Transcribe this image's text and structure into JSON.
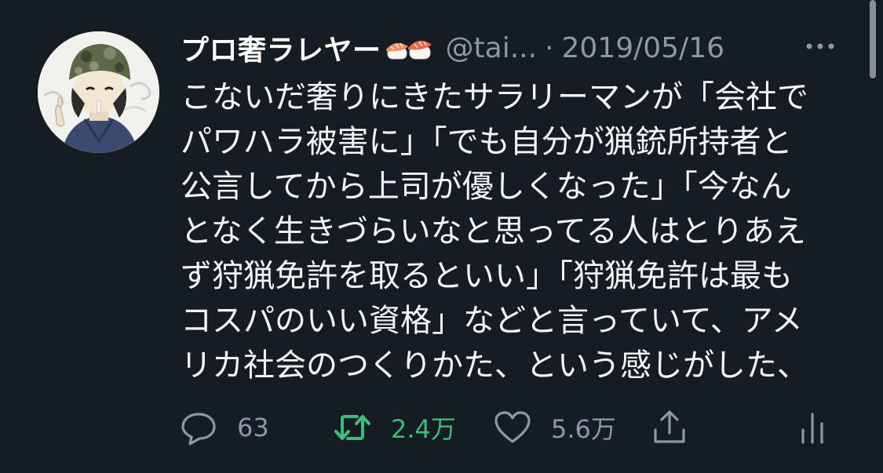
{
  "tweet": {
    "display_name": "プロ奢ラレヤー",
    "handle": "@tai...",
    "separator": "·",
    "date": "2019/05/16",
    "body_lines": [
      "こないだ奢りにきたサラリーマンが「会社で",
      "パワハラ被害に」「でも自分が猟銃所持者と",
      "公言してから上司が優しくなった」「今なん",
      "となく生きづらいなと思ってる人はとりあえ",
      "ず狩猟免許を取るといい」「狩猟免許は最も",
      "コスパのいい資格」などと言っていて、アメ",
      "リカ社会のつくりかた、という感じがした、"
    ],
    "stats": {
      "replies": "63",
      "retweets": "2.4万",
      "likes": "5.6万"
    }
  },
  "icons": {
    "avatar": "avatar-illustration",
    "name_emoji": "sushi-emoji",
    "more": "more-dots-icon",
    "reply": "reply-bubble-icon",
    "retweet": "retweet-icon",
    "like": "heart-icon",
    "share": "share-icon",
    "analytics": "analytics-icon"
  },
  "colors": {
    "background": "#151c24",
    "text": "#ffffff",
    "secondary": "#8b98a5",
    "retweet_active": "#3fba7a"
  }
}
